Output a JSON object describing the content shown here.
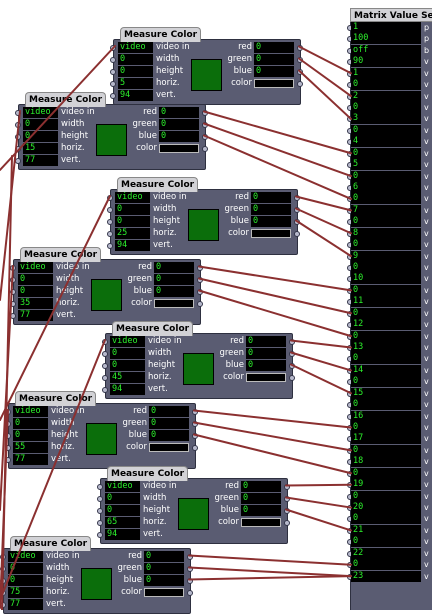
{
  "actor_labels": {
    "title": "Measure Color",
    "inputs": [
      "video in",
      "width",
      "height",
      "horiz.",
      "vert."
    ],
    "outputs": [
      "red",
      "green",
      "blue",
      "color"
    ]
  },
  "actors": [
    {
      "video": "video",
      "width": "0",
      "height": "0",
      "horiz": "5",
      "vert": "94",
      "red": "0",
      "green": "0",
      "blue": "0"
    },
    {
      "video": "video",
      "width": "0",
      "height": "0",
      "horiz": "15",
      "vert": "77",
      "red": "0",
      "green": "0",
      "blue": "0"
    },
    {
      "video": "video",
      "width": "0",
      "height": "0",
      "horiz": "25",
      "vert": "94",
      "red": "0",
      "green": "0",
      "blue": "0"
    },
    {
      "video": "video",
      "width": "0",
      "height": "0",
      "horiz": "35",
      "vert": "77",
      "red": "0",
      "green": "0",
      "blue": "0"
    },
    {
      "video": "video",
      "width": "0",
      "height": "0",
      "horiz": "45",
      "vert": "94",
      "red": "0",
      "green": "0",
      "blue": "0"
    },
    {
      "video": "video",
      "width": "0",
      "height": "0",
      "horiz": "55",
      "vert": "77",
      "red": "0",
      "green": "0",
      "blue": "0"
    },
    {
      "video": "video",
      "width": "0",
      "height": "0",
      "horiz": "65",
      "vert": "94",
      "red": "0",
      "green": "0",
      "blue": "0"
    },
    {
      "video": "video",
      "width": "0",
      "height": "0",
      "horiz": "75",
      "vert": "77",
      "red": "0",
      "green": "0",
      "blue": "0"
    }
  ],
  "matrix": {
    "title": "Matrix Value Se",
    "rows": [
      {
        "value": "1",
        "label": "p"
      },
      {
        "value": "100",
        "label": "p"
      },
      {
        "value": "off",
        "label": "b"
      },
      {
        "value": "90",
        "label": "v"
      },
      {
        "value": "1",
        "label": "v"
      },
      {
        "value": "0",
        "label": "v"
      },
      {
        "value": "2",
        "label": "v"
      },
      {
        "value": "0",
        "label": "v"
      },
      {
        "value": "3",
        "label": "v"
      },
      {
        "value": "0",
        "label": "v"
      },
      {
        "value": "4",
        "label": "v"
      },
      {
        "value": "0",
        "label": "v"
      },
      {
        "value": "5",
        "label": "v"
      },
      {
        "value": "0",
        "label": "v"
      },
      {
        "value": "6",
        "label": "v"
      },
      {
        "value": "0",
        "label": "v"
      },
      {
        "value": "7",
        "label": "v"
      },
      {
        "value": "0",
        "label": "v"
      },
      {
        "value": "8",
        "label": "v"
      },
      {
        "value": "0",
        "label": "v"
      },
      {
        "value": "9",
        "label": "v"
      },
      {
        "value": "0",
        "label": "v"
      },
      {
        "value": "10",
        "label": "v"
      },
      {
        "value": "0",
        "label": "v"
      },
      {
        "value": "11",
        "label": "v"
      },
      {
        "value": "0",
        "label": "v"
      },
      {
        "value": "12",
        "label": "v"
      },
      {
        "value": "0",
        "label": "v"
      },
      {
        "value": "13",
        "label": "v"
      },
      {
        "value": "0",
        "label": "v"
      },
      {
        "value": "14",
        "label": "v"
      },
      {
        "value": "0",
        "label": "v"
      },
      {
        "value": "15",
        "label": "v"
      },
      {
        "value": "0",
        "label": "v"
      },
      {
        "value": "16",
        "label": "v"
      },
      {
        "value": "0",
        "label": "v"
      },
      {
        "value": "17",
        "label": "v"
      },
      {
        "value": "0",
        "label": "v"
      },
      {
        "value": "18",
        "label": "v"
      },
      {
        "value": "0",
        "label": "v"
      },
      {
        "value": "19",
        "label": "v"
      },
      {
        "value": "0",
        "label": "v"
      },
      {
        "value": "20",
        "label": "v"
      },
      {
        "value": "0",
        "label": "v"
      },
      {
        "value": "21",
        "label": "v"
      },
      {
        "value": "0",
        "label": "v"
      },
      {
        "value": "22",
        "label": "v"
      },
      {
        "value": "0",
        "label": "v"
      },
      {
        "value": "23",
        "label": "v"
      }
    ]
  },
  "colors": {
    "actor_body": "#5a5c72",
    "field_text": "#2cf02c",
    "swatch": "#0b6e0b",
    "wire": "#8b3030"
  }
}
